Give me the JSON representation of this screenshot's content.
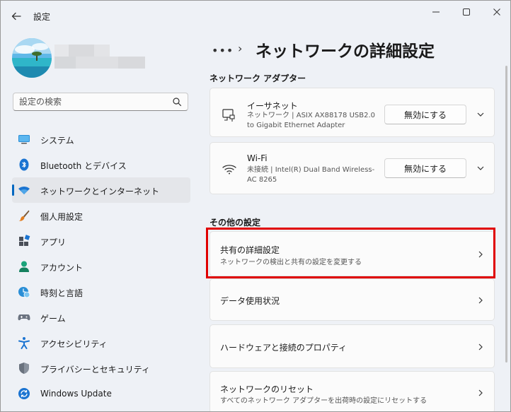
{
  "window": {
    "title": "設定",
    "controls": {
      "minimize": "minimize-icon",
      "maximize": "maximize-icon",
      "close": "close-icon"
    }
  },
  "sidebar": {
    "search_placeholder": "設定の検索",
    "items": [
      {
        "label": "システム",
        "icon": "system-icon",
        "active": false
      },
      {
        "label": "Bluetooth とデバイス",
        "icon": "bluetooth-icon",
        "active": false
      },
      {
        "label": "ネットワークとインターネット",
        "icon": "wifi-icon",
        "active": true
      },
      {
        "label": "個人用設定",
        "icon": "brush-icon",
        "active": false
      },
      {
        "label": "アプリ",
        "icon": "apps-icon",
        "active": false
      },
      {
        "label": "アカウント",
        "icon": "account-icon",
        "active": false
      },
      {
        "label": "時刻と言語",
        "icon": "clock-globe-icon",
        "active": false
      },
      {
        "label": "ゲーム",
        "icon": "gamepad-icon",
        "active": false
      },
      {
        "label": "アクセシビリティ",
        "icon": "accessibility-icon",
        "active": false
      },
      {
        "label": "プライバシーとセキュリティ",
        "icon": "shield-icon",
        "active": false
      },
      {
        "label": "Windows Update",
        "icon": "update-icon",
        "active": false
      }
    ]
  },
  "breadcrumb": {
    "dots": "•••",
    "separator": "›",
    "title": "ネットワークの詳細設定"
  },
  "adapters": {
    "section_title": "ネットワーク アダプター",
    "items": [
      {
        "name": "イーサネット",
        "desc": "ネットワーク | ASIX AX88178 USB2.0 to Gigabit Ethernet Adapter",
        "button": "無効にする",
        "icon": "ethernet-icon"
      },
      {
        "name": "Wi-Fi",
        "desc": "未接続 | Intel(R) Dual Band Wireless-AC 8265",
        "button": "無効にする",
        "icon": "wifi-icon"
      }
    ]
  },
  "other": {
    "section_title": "その他の設定",
    "items": [
      {
        "title": "共有の詳細設定",
        "subtitle": "ネットワークの検出と共有の設定を変更する"
      },
      {
        "title": "データ使用状況",
        "subtitle": ""
      },
      {
        "title": "ハードウェアと接続のプロパティ",
        "subtitle": ""
      },
      {
        "title": "ネットワークのリセット",
        "subtitle": "すべてのネットワーク アダプターを出荷時の設定にリセットする"
      }
    ]
  },
  "colors": {
    "accent": "#0067c0",
    "highlight": "#e00000"
  }
}
